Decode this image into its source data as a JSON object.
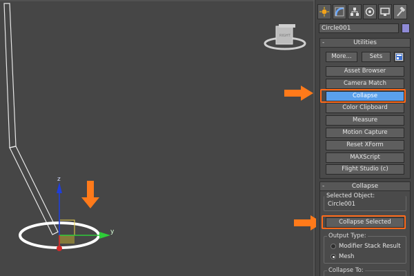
{
  "viewport": {
    "viewcube_label": "RIGHT",
    "axis_labels": {
      "z": "z",
      "y": "y"
    }
  },
  "panel": {
    "tabs": [
      {
        "name": "create",
        "icon": "sun-icon"
      },
      {
        "name": "modify",
        "icon": "modify-icon"
      },
      {
        "name": "hierarchy",
        "icon": "hierarchy-icon"
      },
      {
        "name": "motion",
        "icon": "motion-icon"
      },
      {
        "name": "display",
        "icon": "display-icon"
      },
      {
        "name": "utilities",
        "icon": "hammer-icon"
      }
    ],
    "object_name": "Circle001",
    "object_color": "#8e8ad6",
    "utilities": {
      "title": "Utilities",
      "collapse_toggle": "-",
      "more_label": "More...",
      "sets_label": "Sets",
      "buttons": [
        "Asset Browser",
        "Camera Match",
        "Collapse",
        "Color Clipboard",
        "Measure",
        "Motion Capture",
        "Reset XForm",
        "MAXScript",
        "Flight Studio (c)"
      ],
      "active_button": "Collapse"
    },
    "collapse": {
      "title": "Collapse",
      "collapse_toggle": "-",
      "selected_object_label": "Selected Object:",
      "selected_object_value": "Circle001",
      "collapse_selected_label": "Collapse Selected",
      "output_type_label": "Output Type:",
      "options": [
        "Modifier Stack Result",
        "Mesh"
      ],
      "selected_option": "Mesh",
      "collapse_to_label": "Collapse To:"
    }
  },
  "colors": {
    "highlight": "#ff6a1a",
    "active_button": "#5aa0ec"
  }
}
